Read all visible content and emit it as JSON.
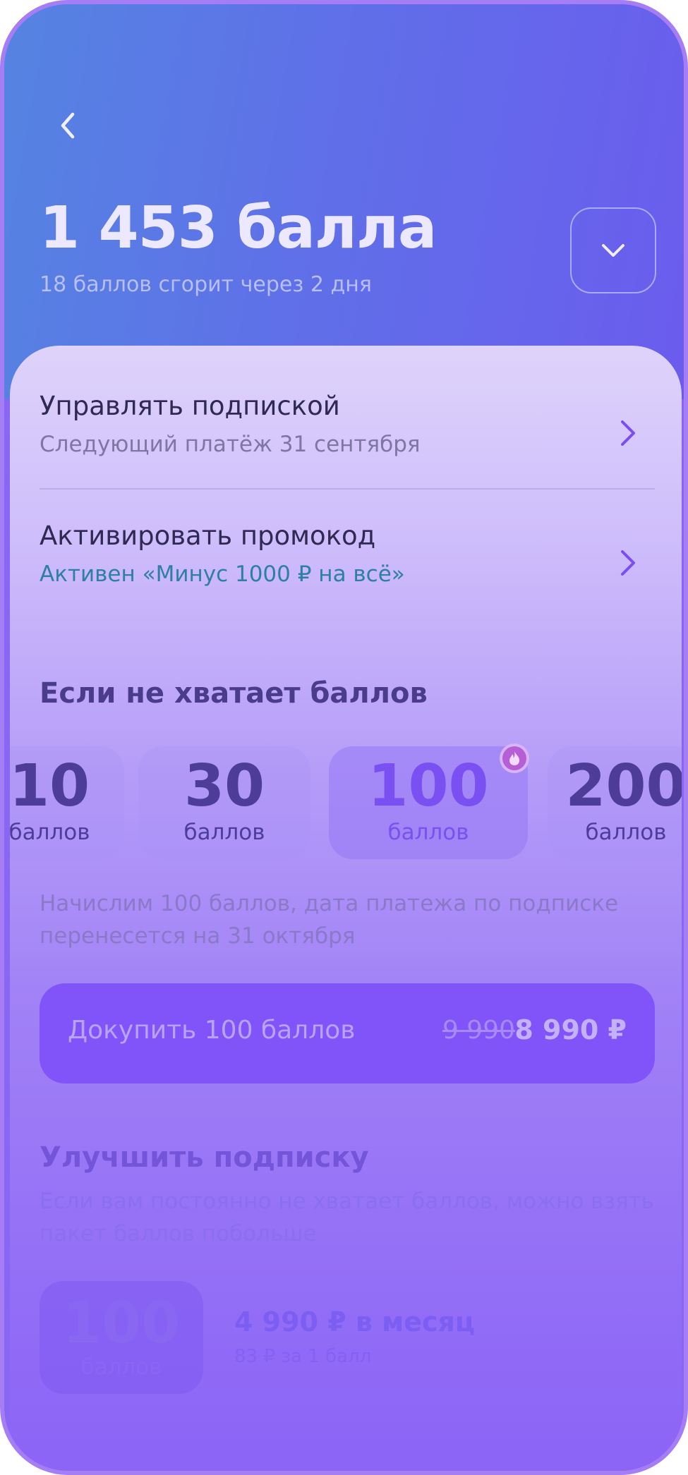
{
  "balance": {
    "title": "1 453 балла",
    "expiry_note": "18 баллов сгорит через 2 дня"
  },
  "menu": [
    {
      "title": "Управлять подпиской",
      "subtitle": "Следующий платёж 31 сентября"
    },
    {
      "title": "Активировать промокод",
      "subtitle": "Активен «Минус 1000 ₽ на всё»"
    }
  ],
  "top_up": {
    "title": "Если не хватает баллов",
    "packs": [
      {
        "amount": "10",
        "unit": "баллов"
      },
      {
        "amount": "30",
        "unit": "баллов"
      },
      {
        "amount": "100",
        "unit": "баллов",
        "selected": true,
        "badge": "fire-icon"
      },
      {
        "amount": "200",
        "unit": "баллов"
      }
    ],
    "note": "Начислим 100 баллов, дата платежа по подписке перенесется на 31 октября",
    "button": {
      "label": "Докупить 100 баллов",
      "old_price": "9 990",
      "new_price": "8 990 ₽"
    }
  },
  "upgrade": {
    "title": "Улучшить подписку",
    "description": "Если вам постоянно не хватает баллов, можно взять пакет баллов побольше",
    "plan": {
      "amount": "100",
      "unit": "баллов",
      "price": "4 990 ₽ в месяц",
      "per_unit": "83 ₽ за 1 балл"
    }
  },
  "colors": {
    "header_start": "#5584e2",
    "header_end": "#6b5cee",
    "accent": "#8054f8",
    "promo_text": "#2e7fa3"
  }
}
